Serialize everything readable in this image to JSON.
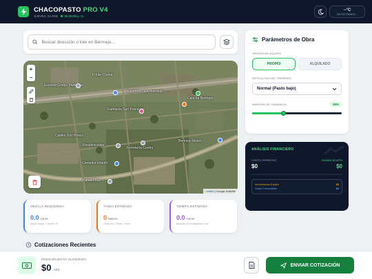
{
  "header": {
    "brand_main": "CHACOPASTO",
    "brand_accent": "PRO V4",
    "date": "JUEVES, 22 ENE",
    "time": "06:28:09 p. m.",
    "weather_temp": "--°C",
    "weather_status": "DETECTANDO..."
  },
  "search": {
    "placeholder": "Buscar dirección o lote en Bermejo..."
  },
  "map": {
    "attribution_link": "Leaflet",
    "attribution_text": "| Google Satellite",
    "labels": {
      "l1": "Escuela Granja Municipal",
      "l2": "Ponte-Chaná",
      "l3": "Supermercado Bermejo",
      "l4": "Farmacia San Francisco",
      "l5": "Cancha Bermejo",
      "l6": "Bermejo Motos",
      "l7": "Capilla Don Bosco",
      "l8": "Residenciales",
      "l9": "Comedor Infantil",
      "l10": "Ferretería Centro",
      "l11": "Parada Bus"
    }
  },
  "stats": [
    {
      "title": "MEZCLA REQUERIDA",
      "value": "0.0",
      "unit": "Litros",
      "sub": "Mejor Super + Aceite 2T",
      "color": "#3b82f6"
    },
    {
      "title": "TANZA ESTIMADA",
      "value": "0",
      "unit": "Metros",
      "sub": "Corte de 2.5mm / 3mm",
      "color": "#f97316"
    },
    {
      "title": "TIEMPO ESTIMADO",
      "value": "0.0",
      "unit": "Horas",
      "sub": "Basado en rendimiento real",
      "color": "#a855f7"
    }
  ],
  "recent": {
    "title": "Cotizaciones Recientes"
  },
  "params": {
    "title": "Parámetros de Obra",
    "origin_label": "ORIGEN DE EQUIPO",
    "origin_options": [
      "PROPIO",
      "ALQUILADO"
    ],
    "origin_selected": "PROPIO",
    "terrain_label": "DIFICULTAD DEL TERRENO",
    "terrain_value": "Normal (Pasto bajo)",
    "margin_label": "MARGEN DE GANANCIA",
    "margin_value": "35%",
    "margin_fraction": 0.35
  },
  "financial": {
    "title": "ANÁLISIS FINANCIERO",
    "cost_label": "COSTO OPERATIVO",
    "cost_value": "$0",
    "gain_label": "GANANCIA NETA",
    "gain_value": "$0",
    "rows": [
      {
        "label": "Amortización Equipo",
        "value": "$0"
      },
      {
        "label": "Gasto Combustible",
        "value": "$0"
      }
    ]
  },
  "footer": {
    "budget_label": "PRESUPUESTO SUGERIDO",
    "budget_value": "$0",
    "currency": "ARS",
    "send_label": "ENVIAR COTIZACIÓN"
  },
  "colors": {
    "header_bg": "#0f172a",
    "accent_green": "#22c55e",
    "button_green": "#15803d"
  }
}
